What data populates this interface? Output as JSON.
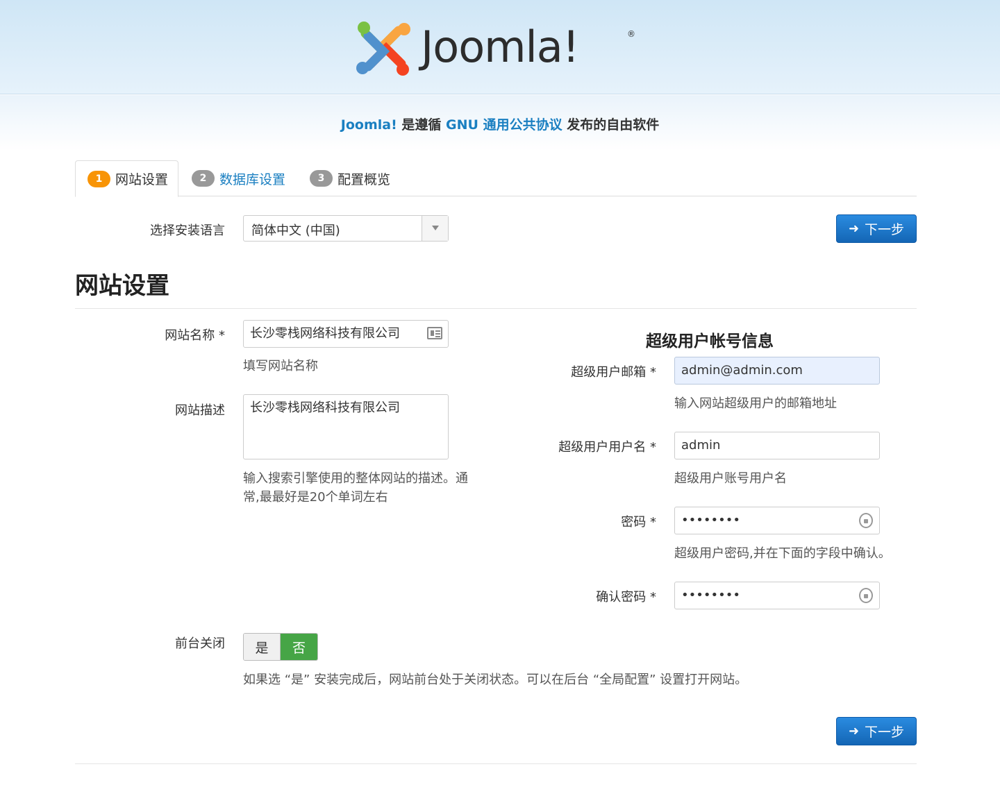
{
  "header": {
    "logo_text": "Joomla!",
    "logo_reg": "®"
  },
  "license": {
    "part1": "Joomla!",
    "part2": "是遵循",
    "part3": "GNU 通用公共协议",
    "part4": "发布的自由软件"
  },
  "tabs": [
    {
      "num": "1",
      "label": "网站设置",
      "active": true
    },
    {
      "num": "2",
      "label": "数据库设置",
      "active": false
    },
    {
      "num": "3",
      "label": "配置概览",
      "active": false
    }
  ],
  "language": {
    "label": "选择安装语言",
    "value": "简体中文 (中国)"
  },
  "buttons": {
    "next_label": "下一步",
    "next_arrow": "➜"
  },
  "page_title": "网站设置",
  "site": {
    "name_label": "网站名称 *",
    "name_value": "长沙零栈网络科技有限公司",
    "name_help": "填写网站名称",
    "desc_label": "网站描述",
    "desc_value": "长沙零栈网络科技有限公司",
    "desc_help_line1": "输入搜索引擎使用的整体网站的描述。通",
    "desc_help_line2": "常,最最好是20个单词左右",
    "offline_label": "前台关闭",
    "offline_yes": "是",
    "offline_no": "否",
    "offline_help": "如果选 “是” 安装完成后，网站前台处于关闭状态。可以在后台 “全局配置” 设置打开网站。"
  },
  "admin": {
    "section_title": "超级用户帐号信息",
    "email_label": "超级用户邮箱 *",
    "email_value": "admin@admin.com",
    "email_help": "输入网站超级用户的邮箱地址",
    "username_label": "超级用户用户名 *",
    "username_value": "admin",
    "username_help": "超级用户账号用户名",
    "password_label": "密码 *",
    "password_value": "••••••••",
    "password_help": "超级用户密码,并在下面的字段中确认。",
    "confirm_label": "确认密码 *",
    "confirm_value": "••••••••"
  },
  "colors": {
    "link_blue": "#1a7fc1",
    "button_blue": "#1466b5",
    "active_badge": "#f89406",
    "toggle_no_green": "#46a546"
  }
}
